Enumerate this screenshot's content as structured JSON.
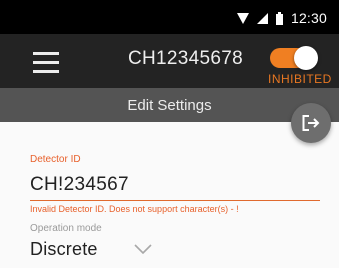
{
  "status_bar": {
    "time": "12:30",
    "icons": [
      "wifi-icon",
      "signal-icon",
      "battery-icon"
    ]
  },
  "app_bar": {
    "menu_icon": "hamburger-menu-icon",
    "title": "CH12345678",
    "inhibit_toggle": {
      "on": true,
      "label": "INHIBITED",
      "color": "#f07f22"
    }
  },
  "sub_header": {
    "title": "Edit Settings",
    "fab_icon": "logout-icon"
  },
  "form": {
    "detector_id": {
      "label": "Detector ID",
      "value": "CH!234567",
      "error": "Invalid Detector ID. Does not support character(s) - !"
    },
    "operation_mode": {
      "label": "Operation mode",
      "value": "Discrete"
    }
  },
  "colors": {
    "accent_orange": "#e87722",
    "error": "#e8612c",
    "app_bar": "#232323",
    "sub_header": "#545454"
  }
}
